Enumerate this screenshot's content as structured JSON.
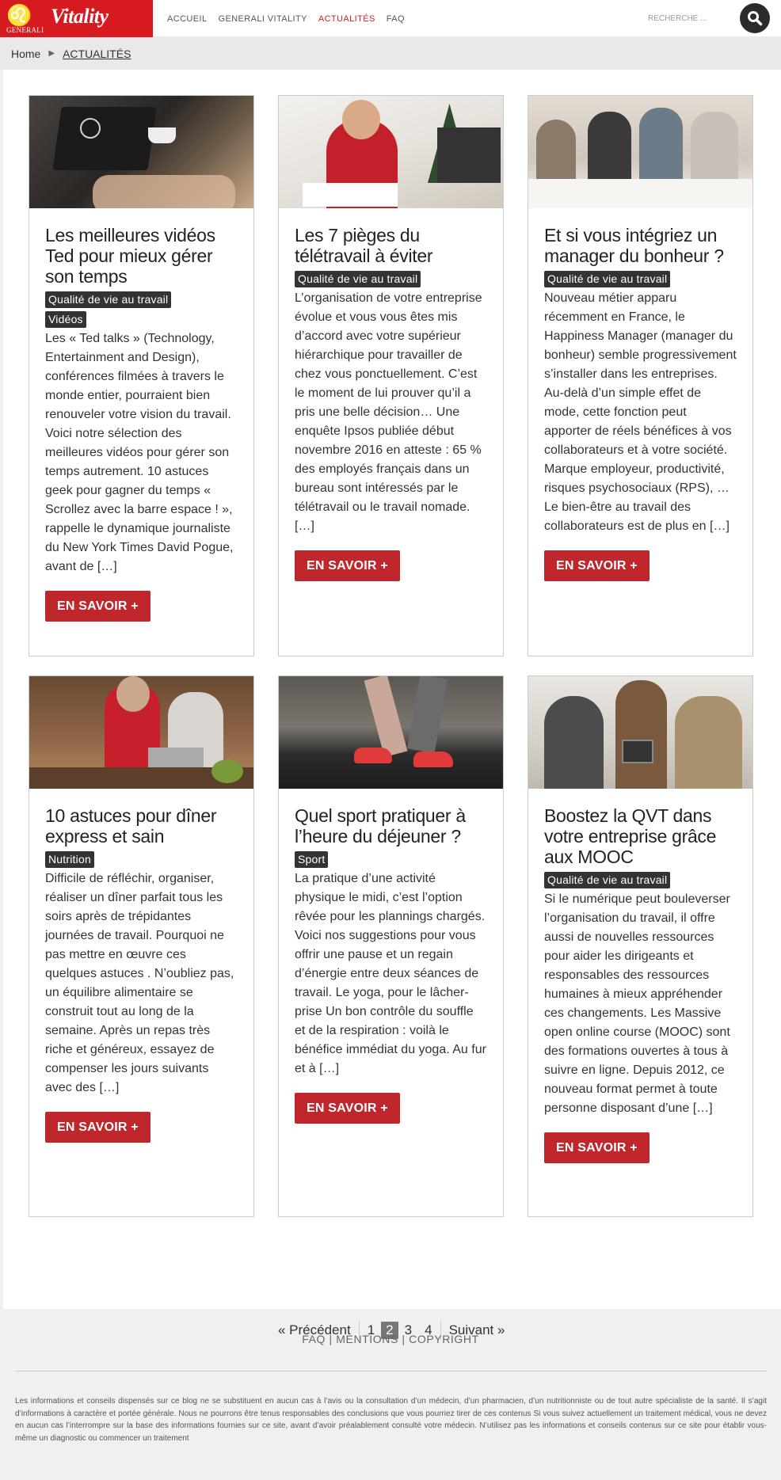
{
  "header": {
    "logo": {
      "brand": "Vitality",
      "company": "GENERALI"
    },
    "nav": [
      {
        "label": "ACCUEIL",
        "active": false
      },
      {
        "label": "GENERALI VITALITY",
        "active": false
      },
      {
        "label": "ACTUALITÉS",
        "active": true
      },
      {
        "label": "FAQ",
        "active": false
      }
    ],
    "search": {
      "placeholder": "RECHERCHE ...",
      "icon": "search-icon"
    }
  },
  "breadcrumb": {
    "home": "Home",
    "current": "ACTUALITÉS"
  },
  "articles": [
    {
      "title": "Les meilleures vidéos Ted pour mieux gérer son temps",
      "tags": [
        "Qualité de vie au travail",
        "Vidéos"
      ],
      "excerpt": "Les « Ted talks » (Technology, Entertainment and Design), conférences filmées à travers le monde entier, pourraient bien renouveler votre vision du travail. Voici notre sélection des meilleures vidéos pour gérer son temps autrement. 10 astuces geek pour gagner du temps « Scrollez avec la barre espace ! », rappelle le dynamique journaliste du New York Times David Pogue, avant de […]",
      "button": "EN SAVOIR +",
      "image": "laptop-video-photo"
    },
    {
      "title": "Les 7 pièges du télétravail à éviter",
      "tags": [
        "Qualité de vie au travail"
      ],
      "excerpt": "L’organisation de votre entreprise évolue et vous vous êtes mis d’accord avec votre supérieur hiérarchique pour travailler de chez vous ponctuellement. C’est le moment de lui prouver qu’il a pris une belle décision… Une enquête Ipsos publiée début novembre 2016 en atteste : 65 % des employés français dans un bureau sont intéressés par le télétravail ou le travail nomade. […]",
      "button": "EN SAVOIR +",
      "image": "man-home-office-photo"
    },
    {
      "title": "Et si vous intégriez un manager du bonheur ?",
      "tags": [
        "Qualité de vie au travail"
      ],
      "excerpt": "Nouveau métier apparu récemment en France, le Happiness Manager (manager du bonheur) semble progressivement s’installer dans les entreprises. Au-delà d’un simple effet de mode, cette fonction peut apporter de réels bénéfices à vos collaborateurs et à votre société. Marque employeur, productivité, risques psychosociaux (RPS), … Le bien-être au travail des collaborateurs est de plus en […]",
      "button": "EN SAVOIR +",
      "image": "team-meeting-photo"
    },
    {
      "title": "10 astuces pour dîner express et sain",
      "tags": [
        "Nutrition"
      ],
      "excerpt": "Difficile de réfléchir, organiser, réaliser un dîner parfait tous les soirs après de trépidantes journées de travail. Pourquoi ne pas mettre en œuvre ces quelques astuces . N’oubliez pas, un équilibre alimentaire se construit tout au long de la semaine. Après un repas très riche et généreux, essayez de compenser les jours suivants avec des […]",
      "button": "EN SAVOIR +",
      "image": "couple-cooking-photo"
    },
    {
      "title": "Quel sport pratiquer à l’heure du déjeuner ?",
      "tags": [
        "Sport"
      ],
      "excerpt": "La pratique d’une activité physique le midi, c’est l’option rêvée pour les plannings chargés. Voici nos suggestions pour vous offrir une pause et un regain d’énergie entre deux séances de travail. Le yoga, pour le lâcher-prise Un bon contrôle du souffle et de la respiration : voilà le bénéfice immédiat du yoga. Au fur et à […]",
      "button": "EN SAVOIR +",
      "image": "treadmill-running-photo"
    },
    {
      "title": "Boostez la QVT dans votre entreprise grâce aux MOOC",
      "tags": [
        "Qualité de vie au travail"
      ],
      "excerpt": "Si le numérique peut bouleverser l’organisation du travail, il offre aussi de nouvelles ressources pour aider les dirigeants et responsables des ressources humaines à mieux appréhender ces changements. Les Massive open online course (MOOC) sont des formations ouvertes à tous à suivre en ligne.  Depuis 2012, ce nouveau format permet à toute personne disposant d’une […]",
      "button": "EN SAVOIR +",
      "image": "group-tablet-photo"
    }
  ],
  "pagination": {
    "prev": "« Précédent",
    "pages": [
      "1",
      "2",
      "3",
      "4"
    ],
    "current": "2",
    "next": "Suivant »"
  },
  "footer": {
    "links": "FAQ | MENTIONS | COPYRIGHT",
    "disclaimer": "Les informations et conseils dispensés sur ce blog ne se substituent en aucun cas à l’avis ou la consultation d’un médecin, d’un pharmacien, d’un nutritionniste ou de tout autre spécialiste de la santé. Il s’agit d’informations à caractère et portée générale. Nous ne pourrons être tenus responsables des conclusions que vous pourriez tirer de ces contenus Si vous suivez actuellement un traitement médical, vous ne devez en aucun cas l’interrompre sur la base des informations fournies sur ce site, avant d’avoir préalablement consulté votre médecin. N’utilisez pas les informations et conseils contenus sur ce site pour établir vous-même un diagnostic ou commencer un traitement"
  },
  "colors": {
    "brand_red": "#d71920",
    "button_red": "#c0272d",
    "tag_bg": "#333333"
  }
}
